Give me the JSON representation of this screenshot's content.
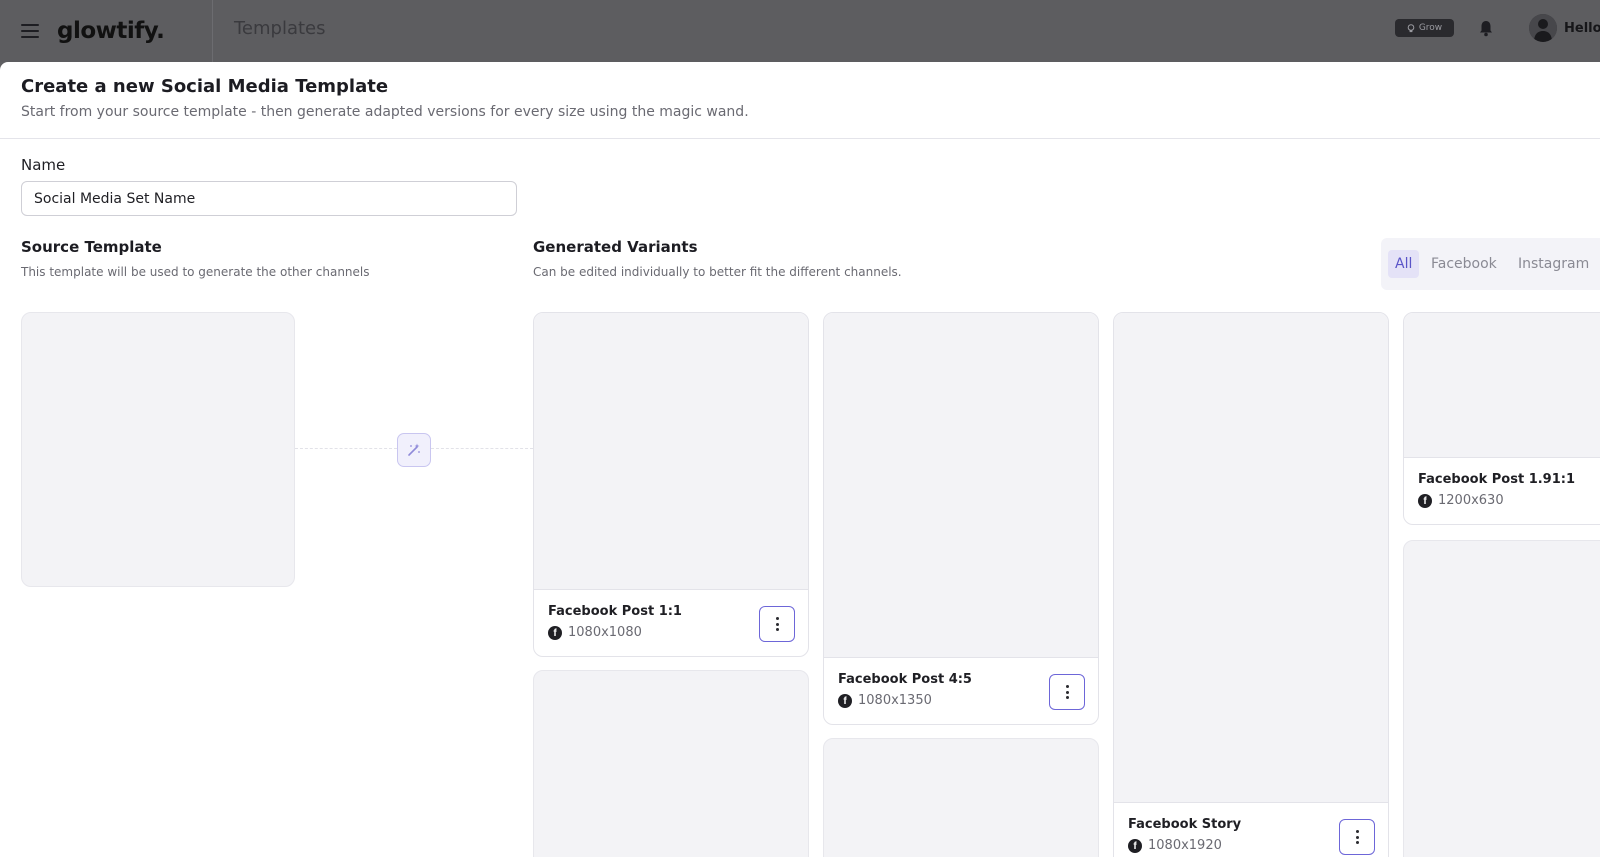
{
  "topbar": {
    "logo": "glowtify.",
    "page_title": "Templates",
    "grow_badge": "Grow",
    "greeting": "Hello,"
  },
  "modal": {
    "title": "Create a new Social Media Template",
    "subtitle": "Start from your source template - then generate adapted versions for every size using the magic wand."
  },
  "form": {
    "name_label": "Name",
    "name_value": "Social Media Set Name"
  },
  "source": {
    "title": "Source Template",
    "subtitle": "This template will be used to generate the other channels"
  },
  "variants": {
    "title": "Generated Variants",
    "subtitle": "Can be edited individually to better fit the different channels.",
    "filters": [
      "All",
      "Facebook",
      "Instagram"
    ],
    "active_filter": "All",
    "items": [
      {
        "name": "Facebook Post 1:1",
        "size": "1080x1080",
        "channel_icon": "facebook-icon"
      },
      {
        "name": "Facebook Post 4:5",
        "size": "1080x1350",
        "channel_icon": "facebook-icon"
      },
      {
        "name": "Facebook Story",
        "size": "1080x1920",
        "channel_icon": "facebook-icon"
      },
      {
        "name": "Facebook Post 1.91:1",
        "size": "1200x630",
        "channel_icon": "facebook-icon"
      }
    ]
  },
  "colors": {
    "accent": "#6d66d8",
    "card_bg": "#f3f3f6",
    "overlay_bar": "#5d5d60"
  }
}
